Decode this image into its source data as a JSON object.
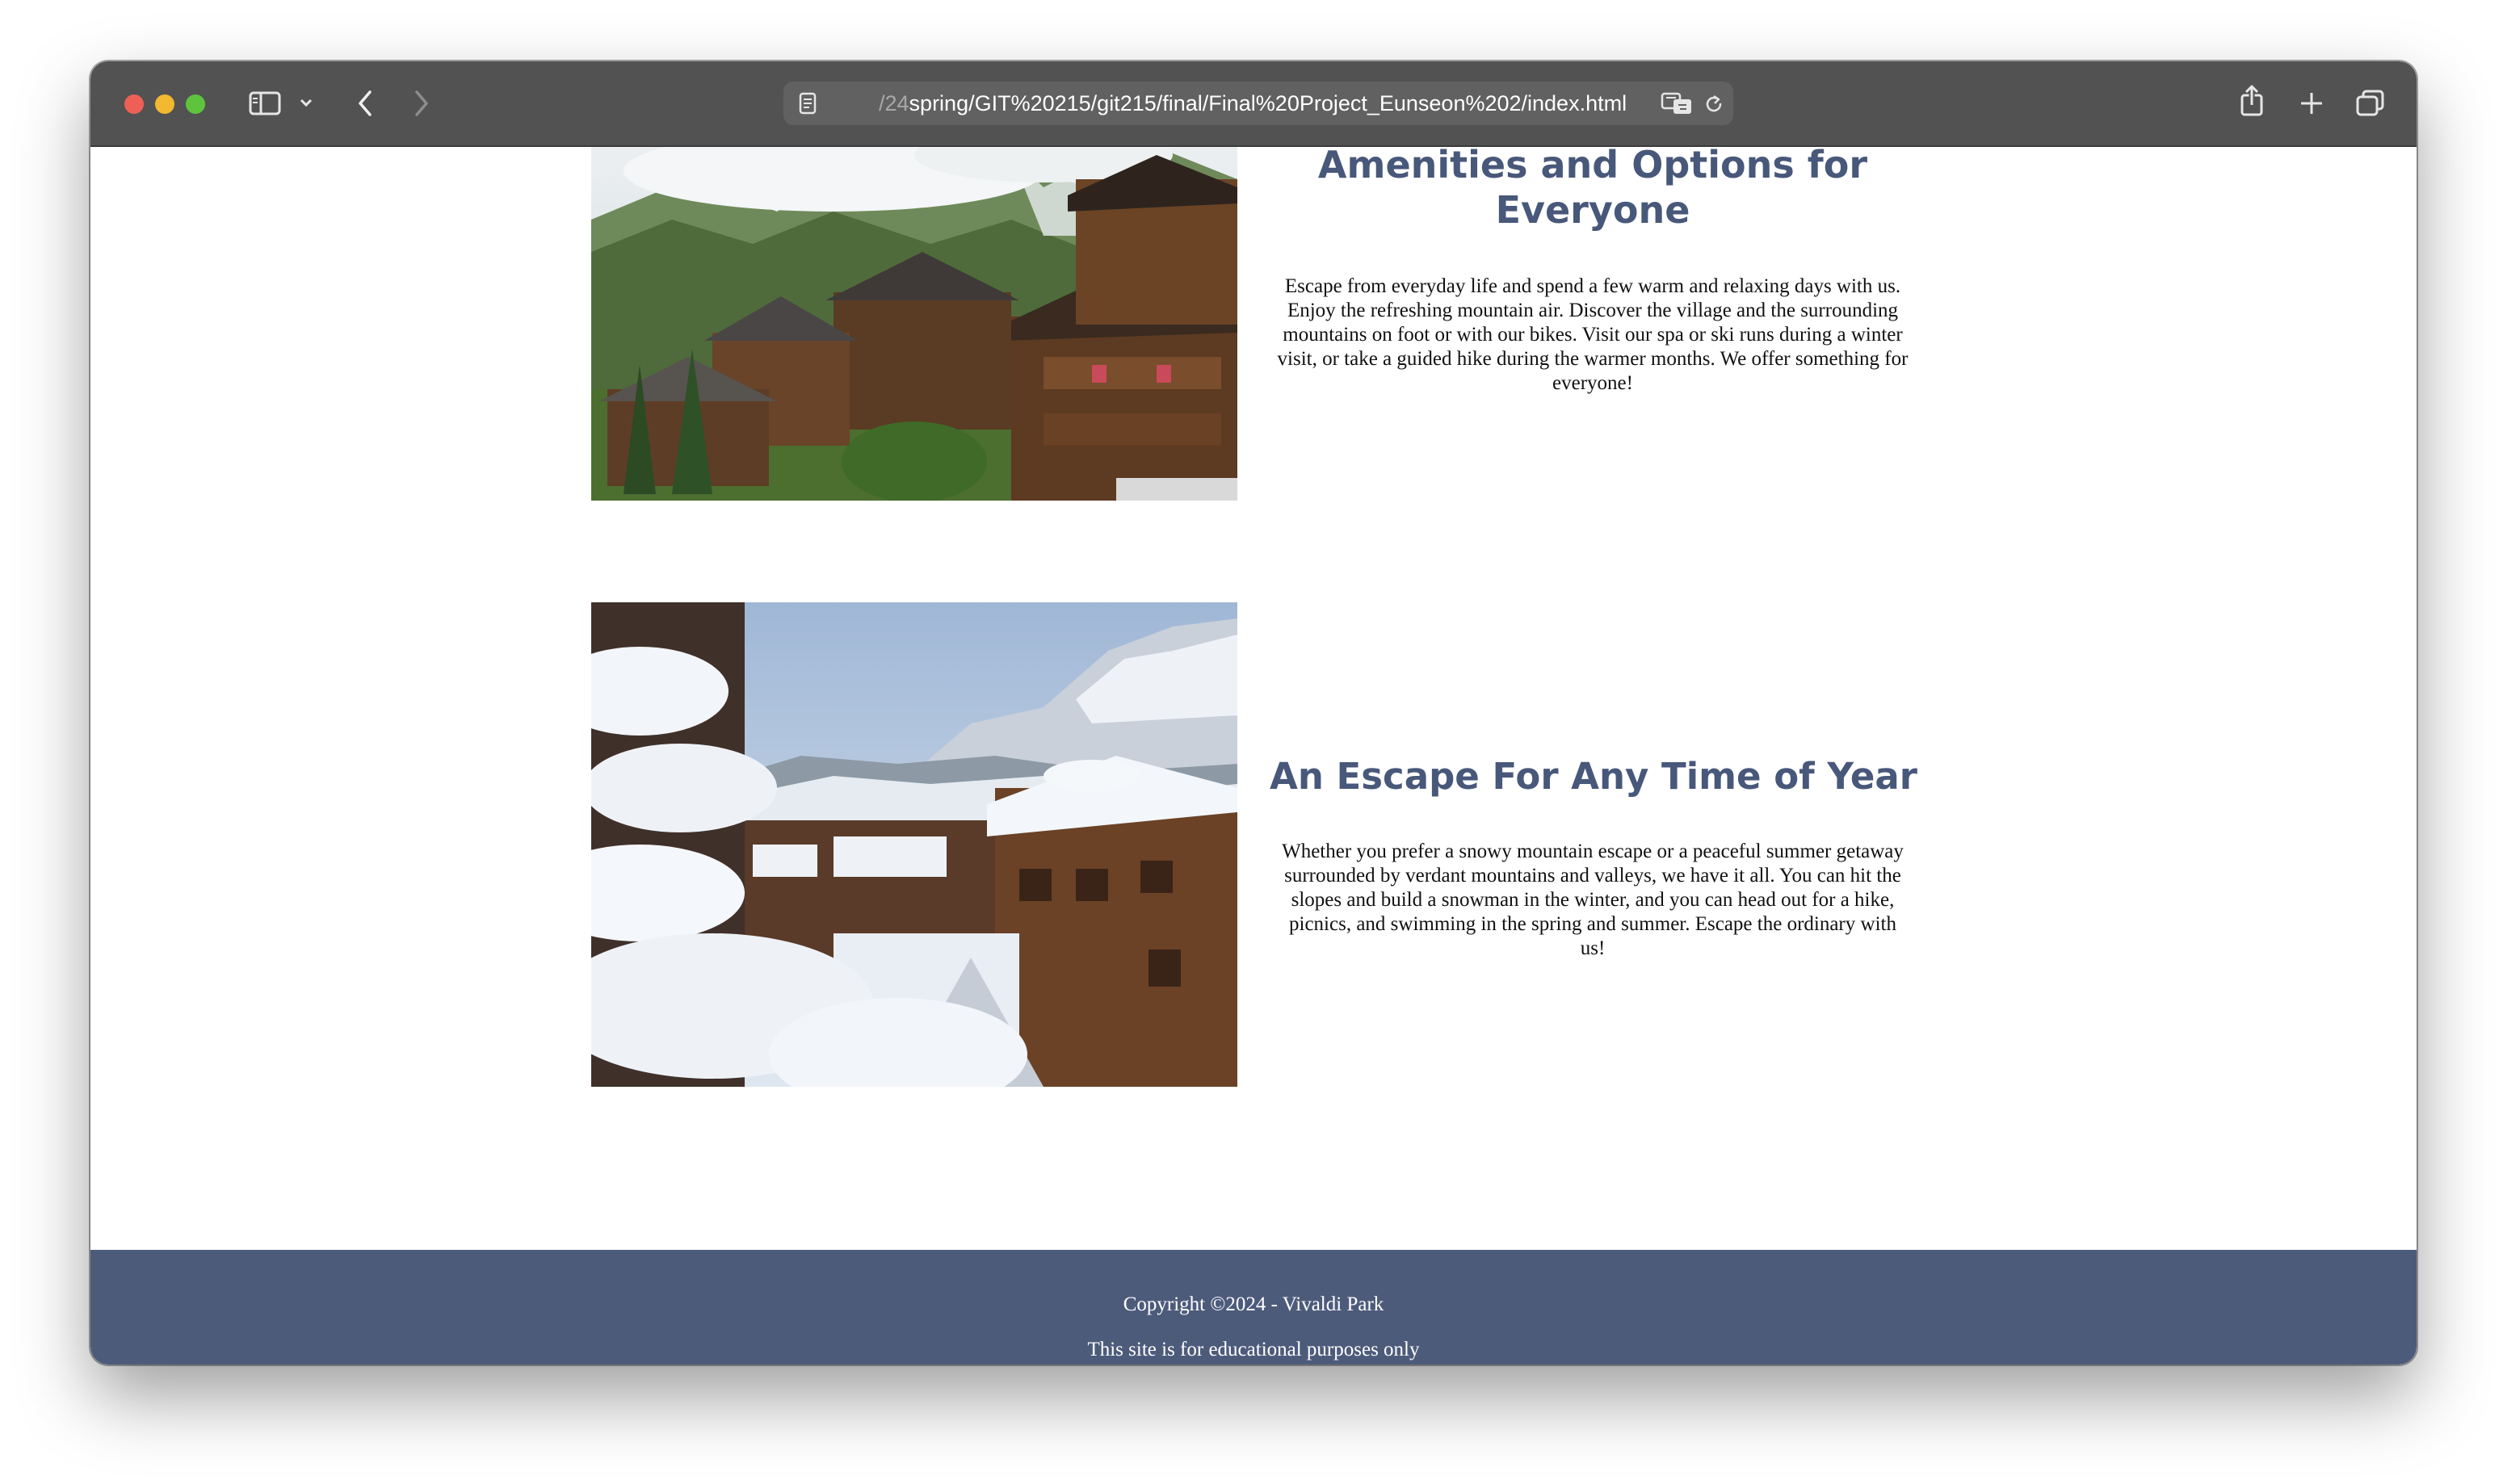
{
  "browser": {
    "url_dim": "/24",
    "url_main": "spring/GIT%20215/git215/final/Final%20Project_Eunseon%202/index.html",
    "icons": [
      "sidebar-icon",
      "chevron-down-icon",
      "back-icon",
      "forward-icon",
      "reader-icon",
      "translate-icon",
      "reload-icon",
      "share-icon",
      "new-tab-icon",
      "tabs-overview-icon"
    ]
  },
  "sections": [
    {
      "heading": "Amenities and Options for Everyone",
      "body": "Escape from everyday life and spend a few warm and relaxing days with us. Enjoy the refreshing mountain air. Discover the village and the surrounding mountains on foot or with our bikes. Visit our spa or ski runs during a winter visit, or take a guided hike during the warmer months. We offer something for everyone!"
    },
    {
      "heading": "An Escape For Any Time of Year",
      "body": "Whether you prefer a snowy mountain escape or a peaceful summer getaway surrounded by verdant mountains and valleys, we have it all. You can hit the slopes and build a snowman in the winter, and you can head out for a hike, picnics, and swimming in the spring and summer. Escape the ordinary with us!"
    }
  ],
  "footer": {
    "copyright": "Copyright ©2024 - Vivaldi Park",
    "note": "This site is for educational purposes only"
  },
  "colors": {
    "heading": "#48587a",
    "footer_bg": "#4d5b7b",
    "toolbar_bg": "#525252"
  }
}
